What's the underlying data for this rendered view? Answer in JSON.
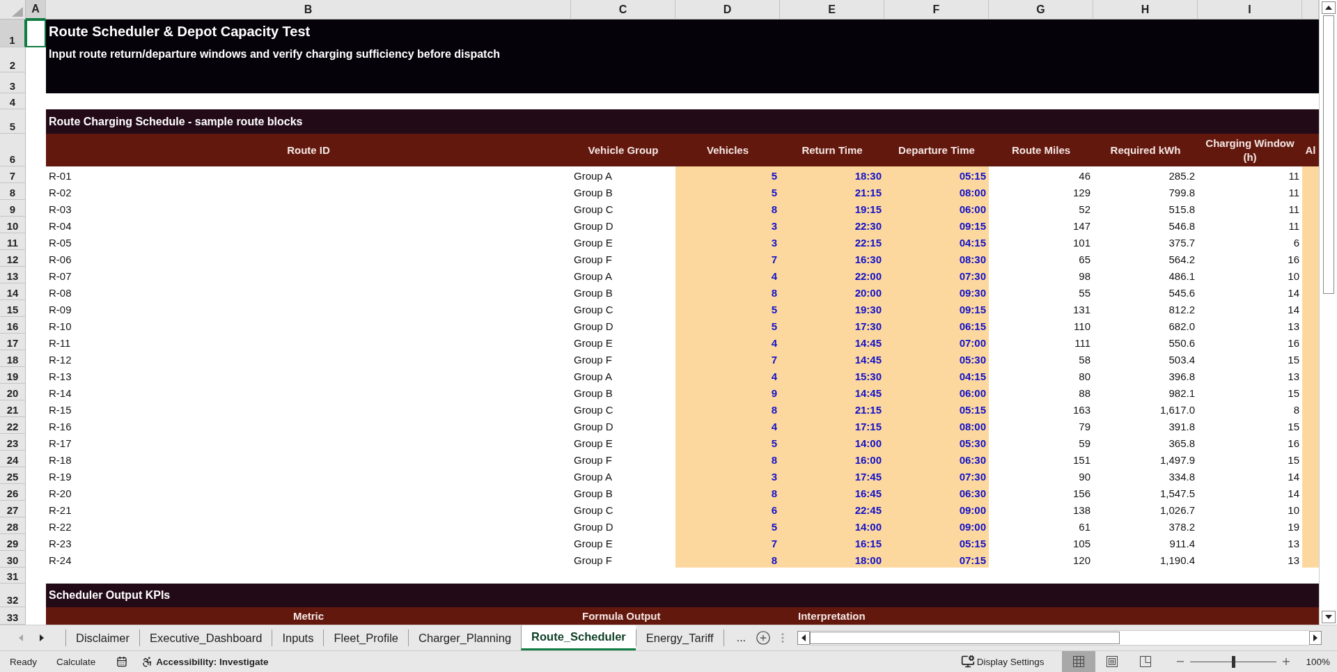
{
  "sheet": {
    "column_headers": [
      {
        "label": "A",
        "selected": true
      },
      {
        "label": "B",
        "selected": false
      },
      {
        "label": "C",
        "selected": false
      },
      {
        "label": "D",
        "selected": false
      },
      {
        "label": "E",
        "selected": false
      },
      {
        "label": "F",
        "selected": false
      },
      {
        "label": "G",
        "selected": false
      },
      {
        "label": "H",
        "selected": false
      },
      {
        "label": "I",
        "selected": false
      }
    ],
    "row_headers": [
      {
        "label": "1",
        "selected": true
      },
      {
        "label": "2",
        "selected": false
      },
      {
        "label": "3",
        "selected": false
      },
      {
        "label": "4",
        "selected": false
      },
      {
        "label": "5",
        "selected": false
      },
      {
        "label": "6",
        "selected": false
      },
      {
        "label": "7",
        "selected": false
      },
      {
        "label": "8",
        "selected": false
      },
      {
        "label": "9",
        "selected": false
      },
      {
        "label": "10",
        "selected": false
      },
      {
        "label": "11",
        "selected": false
      },
      {
        "label": "12",
        "selected": false
      },
      {
        "label": "13",
        "selected": false
      },
      {
        "label": "14",
        "selected": false
      },
      {
        "label": "15",
        "selected": false
      },
      {
        "label": "16",
        "selected": false
      },
      {
        "label": "17",
        "selected": false
      },
      {
        "label": "18",
        "selected": false
      },
      {
        "label": "19",
        "selected": false
      },
      {
        "label": "20",
        "selected": false
      },
      {
        "label": "21",
        "selected": false
      },
      {
        "label": "22",
        "selected": false
      },
      {
        "label": "23",
        "selected": false
      },
      {
        "label": "24",
        "selected": false
      },
      {
        "label": "25",
        "selected": false
      },
      {
        "label": "26",
        "selected": false
      },
      {
        "label": "27",
        "selected": false
      },
      {
        "label": "28",
        "selected": false
      },
      {
        "label": "29",
        "selected": false
      },
      {
        "label": "30",
        "selected": false
      },
      {
        "label": "31",
        "selected": false
      },
      {
        "label": "32",
        "selected": false
      },
      {
        "label": "33",
        "selected": false
      }
    ],
    "title": "Route Scheduler & Depot Capacity Test",
    "subtitle": "Input route return/departure windows and verify charging sufficiency before dispatch",
    "schedule_section": "Route Charging Schedule - sample route blocks",
    "schedule_columns": [
      "Route ID",
      "Vehicle Group",
      "Vehicles",
      "Return Time",
      "Departure Time",
      "Route Miles",
      "Required kWh",
      "Charging Window (h)",
      "Al"
    ],
    "routes": [
      [
        "R-01",
        "Group A",
        "5",
        "18:30",
        "05:15",
        "46",
        "285.2",
        "11"
      ],
      [
        "R-02",
        "Group B",
        "5",
        "21:15",
        "08:00",
        "129",
        "799.8",
        "11"
      ],
      [
        "R-03",
        "Group C",
        "8",
        "19:15",
        "06:00",
        "52",
        "515.8",
        "11"
      ],
      [
        "R-04",
        "Group D",
        "3",
        "22:30",
        "09:15",
        "147",
        "546.8",
        "11"
      ],
      [
        "R-05",
        "Group E",
        "3",
        "22:15",
        "04:15",
        "101",
        "375.7",
        "6"
      ],
      [
        "R-06",
        "Group F",
        "7",
        "16:30",
        "08:30",
        "65",
        "564.2",
        "16"
      ],
      [
        "R-07",
        "Group A",
        "4",
        "22:00",
        "07:30",
        "98",
        "486.1",
        "10"
      ],
      [
        "R-08",
        "Group B",
        "8",
        "20:00",
        "09:30",
        "55",
        "545.6",
        "14"
      ],
      [
        "R-09",
        "Group C",
        "5",
        "19:30",
        "09:15",
        "131",
        "812.2",
        "14"
      ],
      [
        "R-10",
        "Group D",
        "5",
        "17:30",
        "06:15",
        "110",
        "682.0",
        "13"
      ],
      [
        "R-11",
        "Group E",
        "4",
        "14:45",
        "07:00",
        "111",
        "550.6",
        "16"
      ],
      [
        "R-12",
        "Group F",
        "7",
        "14:45",
        "05:30",
        "58",
        "503.4",
        "15"
      ],
      [
        "R-13",
        "Group A",
        "4",
        "15:30",
        "04:15",
        "80",
        "396.8",
        "13"
      ],
      [
        "R-14",
        "Group B",
        "9",
        "14:45",
        "06:00",
        "88",
        "982.1",
        "15"
      ],
      [
        "R-15",
        "Group C",
        "8",
        "21:15",
        "05:15",
        "163",
        "1,617.0",
        "8"
      ],
      [
        "R-16",
        "Group D",
        "4",
        "17:15",
        "08:00",
        "79",
        "391.8",
        "15"
      ],
      [
        "R-17",
        "Group E",
        "5",
        "14:00",
        "05:30",
        "59",
        "365.8",
        "16"
      ],
      [
        "R-18",
        "Group F",
        "8",
        "16:00",
        "06:30",
        "151",
        "1,497.9",
        "15"
      ],
      [
        "R-19",
        "Group A",
        "3",
        "17:45",
        "07:30",
        "90",
        "334.8",
        "14"
      ],
      [
        "R-20",
        "Group B",
        "8",
        "16:45",
        "06:30",
        "156",
        "1,547.5",
        "14"
      ],
      [
        "R-21",
        "Group C",
        "6",
        "22:45",
        "09:00",
        "138",
        "1,026.7",
        "10"
      ],
      [
        "R-22",
        "Group D",
        "5",
        "14:00",
        "09:00",
        "61",
        "378.2",
        "19"
      ],
      [
        "R-23",
        "Group E",
        "7",
        "16:15",
        "05:15",
        "105",
        "911.4",
        "13"
      ],
      [
        "R-24",
        "Group F",
        "8",
        "18:00",
        "07:15",
        "120",
        "1,190.4",
        "13"
      ]
    ],
    "kpi_section": "Scheduler Output KPIs",
    "kpi_columns": [
      "Metric",
      "Formula Output",
      "Interpretation"
    ]
  },
  "sheet_tabs": [
    {
      "label": "Disclaimer",
      "selected": false
    },
    {
      "label": "Executive_Dashboard",
      "selected": false
    },
    {
      "label": "Inputs",
      "selected": false
    },
    {
      "label": "Fleet_Profile",
      "selected": false
    },
    {
      "label": "Charger_Planning",
      "selected": false
    },
    {
      "label": "Route_Scheduler",
      "selected": true
    },
    {
      "label": "Energy_Tariff",
      "selected": false
    }
  ],
  "more_tabs": "...",
  "status_bar": {
    "mode": "Ready",
    "calculate": "Calculate",
    "accessibility": "Accessibility: Investigate",
    "display_settings": "Display Settings",
    "views": [
      {
        "kind": "normal",
        "selected": true
      },
      {
        "kind": "page_layout",
        "selected": false
      },
      {
        "kind": "page_break",
        "selected": false
      }
    ],
    "zoom": {
      "label": "100%",
      "level": 0.5
    }
  }
}
